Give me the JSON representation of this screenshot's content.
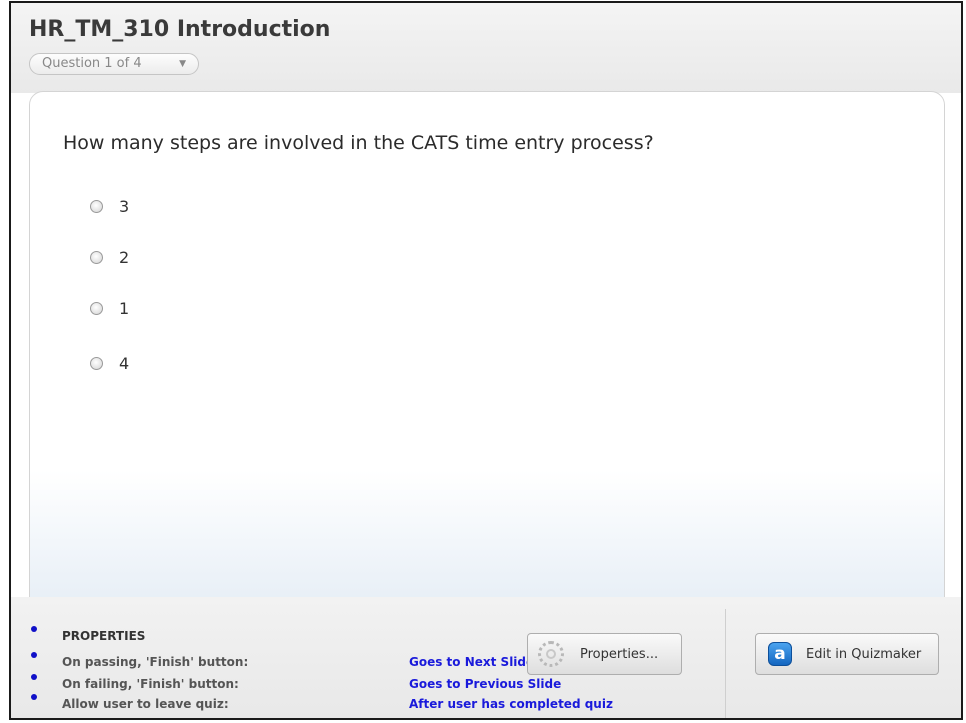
{
  "quiz": {
    "title": "HR_TM_310 Introduction",
    "question_selector": "Question 1 of 4",
    "question_text": "How many steps are involved in the CATS time entry process?",
    "choices": [
      "3",
      "2",
      "1",
      "4"
    ]
  },
  "properties": {
    "heading": "PROPERTIES",
    "rows": [
      {
        "label": "On passing, 'Finish' button:",
        "value": "Goes to Next Slide"
      },
      {
        "label": "On failing, 'Finish' button:",
        "value": "Goes to Previous Slide"
      },
      {
        "label": "Allow user to leave quiz:",
        "value": "After user has completed quiz"
      }
    ]
  },
  "buttons": {
    "properties_label": "Properties...",
    "edit_label": "Edit in Quizmaker",
    "edit_icon_glyph": "a"
  },
  "icons": [
    "chevron-down-icon",
    "radio-icon",
    "gear-icon",
    "quizmaker-icon"
  ],
  "colors": {
    "link_blue": "#1a1adb",
    "bullet_blue": "#1010c8",
    "frame": "#1a1a1a"
  }
}
